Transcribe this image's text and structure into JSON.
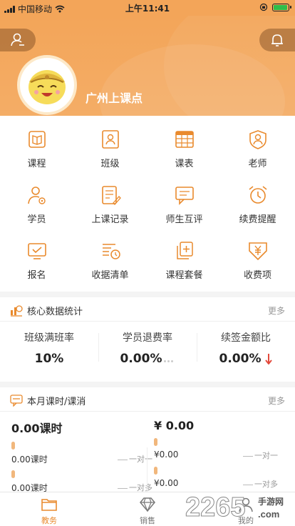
{
  "status_bar": {
    "carrier": "中国移动",
    "time": "上午11:41",
    "battery_percent": 95
  },
  "header": {
    "school_name": "广州上课点"
  },
  "grid": [
    {
      "label": "课程",
      "icon": "book-icon"
    },
    {
      "label": "班级",
      "icon": "class-icon"
    },
    {
      "label": "课表",
      "icon": "timetable-icon"
    },
    {
      "label": "老师",
      "icon": "teacher-icon"
    },
    {
      "label": "学员",
      "icon": "student-icon"
    },
    {
      "label": "上课记录",
      "icon": "record-icon"
    },
    {
      "label": "师生互评",
      "icon": "chat-icon"
    },
    {
      "label": "续费提醒",
      "icon": "alarm-icon"
    },
    {
      "label": "报名",
      "icon": "enroll-icon"
    },
    {
      "label": "收据清单",
      "icon": "receipt-icon"
    },
    {
      "label": "课程套餐",
      "icon": "package-icon"
    },
    {
      "label": "收费项",
      "icon": "fee-icon"
    }
  ],
  "core_stats": {
    "title": "核心数据统计",
    "more": "更多",
    "items": [
      {
        "label": "班级满班率",
        "value": "10%"
      },
      {
        "label": "学员退费率",
        "value": "0.00%"
      },
      {
        "label": "续签金额比",
        "value": "0.00%"
      }
    ]
  },
  "monthly": {
    "title": "本月课时/课消",
    "more": "更多",
    "left_total": "0.00课时",
    "right_total": "¥ 0.00",
    "left_rows": [
      {
        "value": "0.00课时",
        "label": "一对一"
      },
      {
        "value": "0.00课时",
        "label": "一对多"
      }
    ],
    "right_rows": [
      {
        "value": "¥0.00",
        "label": "一对一"
      },
      {
        "value": "¥0.00",
        "label": "一对多"
      }
    ]
  },
  "tabbar": [
    {
      "label": "教务",
      "active": true
    },
    {
      "label": "销售",
      "active": false
    },
    {
      "label": "我的",
      "active": false
    }
  ],
  "watermark": {
    "text": "2265",
    "sub": "手游网",
    "domain": ".com"
  },
  "colors": {
    "accent": "#f3a559",
    "accent_dark": "#e98a2d",
    "down_arrow": "#e34a3c"
  }
}
